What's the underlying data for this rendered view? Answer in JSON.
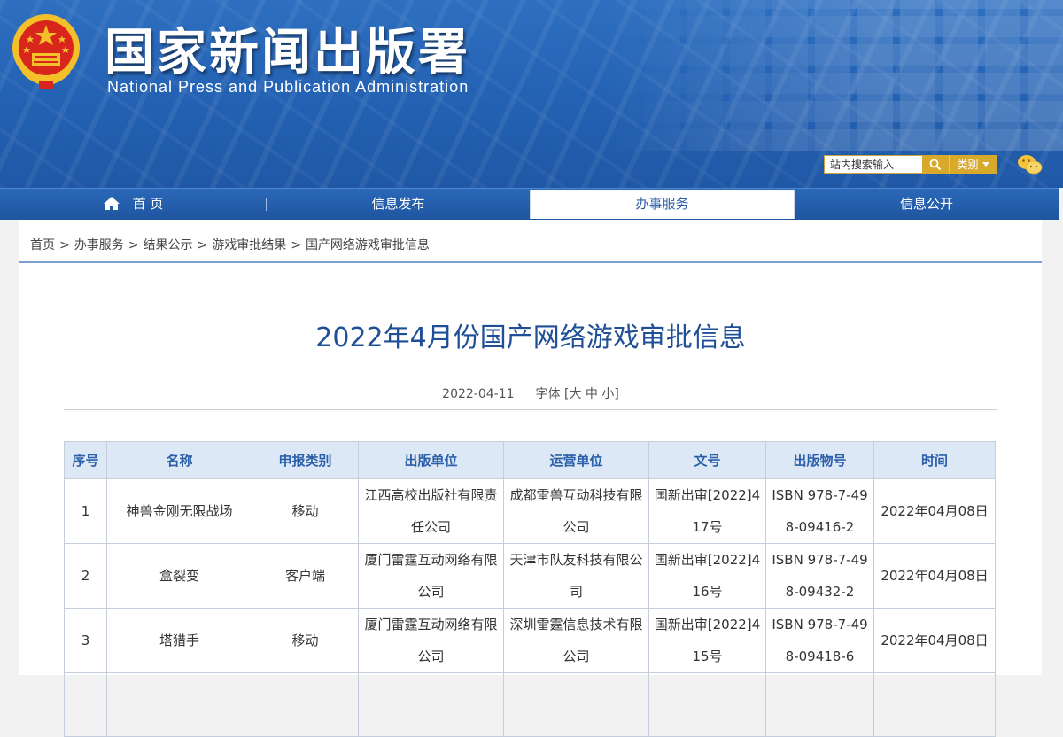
{
  "header": {
    "title_cn": "国家新闻出版署",
    "title_en": "National  Press and Publication Administration",
    "search_placeholder": "站内搜索输入",
    "category_label": "类别"
  },
  "nav": {
    "items": [
      {
        "label": "首 页",
        "icon": "home-icon"
      },
      {
        "label": "信息发布"
      },
      {
        "label": "办事服务",
        "active": true
      },
      {
        "label": "信息公开"
      }
    ]
  },
  "breadcrumb": [
    "首页",
    "办事服务",
    "结果公示",
    "游戏审批结果",
    "国产网络游戏审批信息"
  ],
  "breadcrumb_sep": ">",
  "article": {
    "title": "2022年4月份国产网络游戏审批信息",
    "date": "2022-04-11",
    "font_size_label": "字体 [大 中 小]"
  },
  "table": {
    "headers": [
      "序号",
      "名称",
      "申报类别",
      "出版单位",
      "运营单位",
      "文号",
      "出版物号",
      "时间"
    ],
    "rows": [
      [
        "1",
        "神兽金刚无限战场",
        "移动",
        "江西高校出版社有限责任公司",
        "成都雷兽互动科技有限公司",
        "国新出审[2022]417号",
        "ISBN 978-7-498-09416-2",
        "2022年04月08日"
      ],
      [
        "2",
        "盒裂变",
        "客户端",
        "厦门雷霆互动网络有限公司",
        "天津市队友科技有限公司",
        "国新出审[2022]416号",
        "ISBN 978-7-498-09432-2",
        "2022年04月08日"
      ],
      [
        "3",
        "塔猎手",
        "移动",
        "厦门雷霆互动网络有限公司",
        "深圳雷霆信息技术有限公司",
        "国新出审[2022]415号",
        "ISBN 978-7-498-09418-6",
        "2022年04月08日"
      ],
      [
        "",
        "",
        "",
        "",
        "",
        "",
        "",
        ""
      ]
    ]
  },
  "colors": {
    "brand_blue": "#2563b5",
    "title_blue": "#1f4f96",
    "accent_gold": "#d9a92b"
  }
}
